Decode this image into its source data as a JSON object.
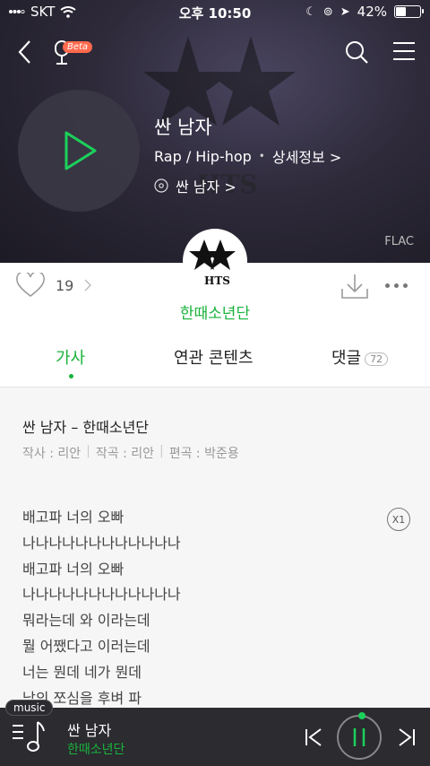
{
  "status": {
    "carrier": "SKT",
    "time": "오후 10:50",
    "battery": "42%",
    "battery_level": 0.42
  },
  "nav": {
    "beta_label": "Beta"
  },
  "song": {
    "title": "싼 남자",
    "genre": "Rap / Hip-hop",
    "detail_link": "상세정보 >",
    "album": "싼 남자 >",
    "quality": "FLAC"
  },
  "artist": {
    "name": "한때소년단",
    "likes": "19",
    "logo_text": "HTS"
  },
  "tabs": [
    {
      "label": "가사"
    },
    {
      "label": "연관 콘텐츠"
    },
    {
      "label": "댓글",
      "badge": "72"
    }
  ],
  "lyrics": {
    "heading": "싼 남자 – 한때소년단",
    "credits": [
      "작사 : 리안",
      "작곡 : 리안",
      "편곡 : 박준용"
    ],
    "speed": "X1",
    "lines": [
      "배고파 너의 오빠",
      "나나나나나나나나나나나나",
      "배고파 너의 오빠",
      "나나나나나나나나나나나나",
      "뭐라는데 와 이라는데",
      "뭘 어쨌다고 이러는데",
      "너는 뭔데 네가 뭔데",
      "남의 쪼심을 후벼 파"
    ]
  },
  "player": {
    "tag": "music",
    "title": "싼 남자",
    "artist": "한때소년단"
  },
  "colors": {
    "accent": "#19b33b",
    "player_bg": "#2b2b30"
  }
}
